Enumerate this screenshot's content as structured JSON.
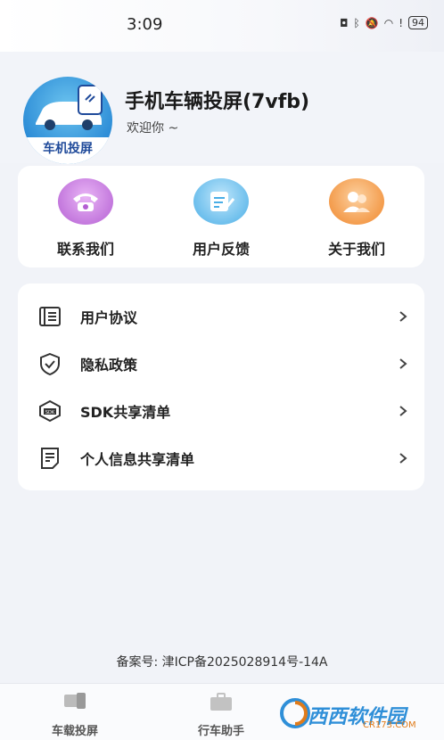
{
  "status_bar": {
    "time": "3:09",
    "battery": "94"
  },
  "app": {
    "title": "手机车辆投屏(7vfb)",
    "welcome": "欢迎你 ~",
    "logo_text": "车机投屏"
  },
  "actions": [
    {
      "label": "联系我们",
      "icon": "phone-icon",
      "color": "#c86fe0"
    },
    {
      "label": "用户反馈",
      "icon": "feedback-icon",
      "color": "#58b6ea"
    },
    {
      "label": "关于我们",
      "icon": "about-icon",
      "color": "#f59a3b"
    }
  ],
  "menu": [
    {
      "label": "用户协议",
      "icon": "document-icon"
    },
    {
      "label": "隐私政策",
      "icon": "shield-icon"
    },
    {
      "label": "SDK共享清单",
      "icon": "sdk-icon"
    },
    {
      "label": "个人信息共享清单",
      "icon": "note-icon"
    }
  ],
  "icp": "备案号: 津ICP备2025028914号-14A",
  "tabs": [
    {
      "label": "车载投屏",
      "icon": "car-screen-icon"
    },
    {
      "label": "行车助手",
      "icon": "briefcase-icon"
    }
  ],
  "watermark": {
    "text": "西西软件园",
    "sub": "CR173.COM"
  }
}
